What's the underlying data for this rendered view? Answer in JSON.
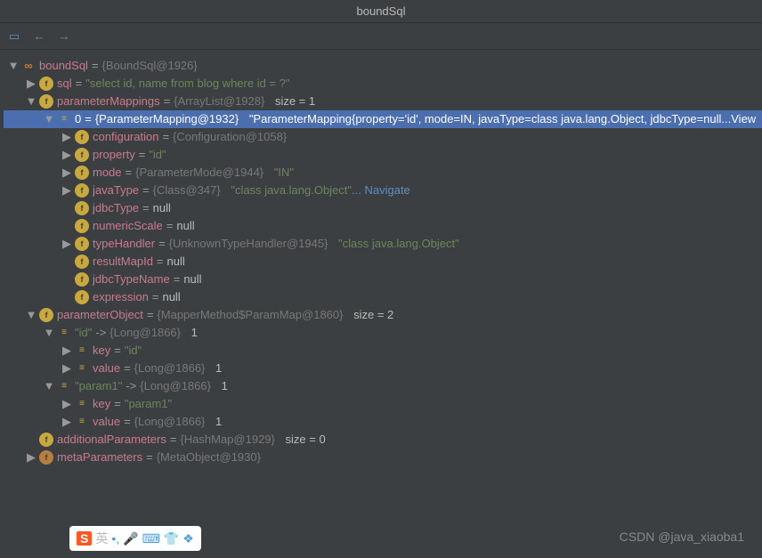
{
  "title": "boundSql",
  "watermark": "CSDN @java_xiaoba1",
  "tree": {
    "root": {
      "name": "boundSql",
      "type": "{BoundSql@1926}"
    },
    "sql": {
      "name": "sql",
      "val": "\"select id, name from blog where id = ?\""
    },
    "parameterMappings": {
      "name": "parameterMappings",
      "type": "{ArrayList@1928}",
      "size": "size = 1"
    },
    "pm0": {
      "name": "0",
      "type": "{ParameterMapping@1932}",
      "val": "\"ParameterMapping{property='id', mode=IN, javaType=class java.lang.Object, jdbcType=null...",
      "view": "View"
    },
    "configuration": {
      "name": "configuration",
      "type": "{Configuration@1058}"
    },
    "property": {
      "name": "property",
      "val": "\"id\""
    },
    "mode": {
      "name": "mode",
      "type": "{ParameterMode@1944}",
      "val": "\"IN\""
    },
    "javaType": {
      "name": "javaType",
      "type": "{Class@347}",
      "val": "\"class java.lang.Object\"",
      "nav": "... Navigate"
    },
    "jdbcType": {
      "name": "jdbcType",
      "val": "null"
    },
    "numericScale": {
      "name": "numericScale",
      "val": "null"
    },
    "typeHandler": {
      "name": "typeHandler",
      "type": "{UnknownTypeHandler@1945}",
      "val": "\"class java.lang.Object\""
    },
    "resultMapId": {
      "name": "resultMapId",
      "val": "null"
    },
    "jdbcTypeName": {
      "name": "jdbcTypeName",
      "val": "null"
    },
    "expression": {
      "name": "expression",
      "val": "null"
    },
    "parameterObject": {
      "name": "parameterObject",
      "type": "{MapperMethod$ParamMap@1860}",
      "size": "size = 2"
    },
    "entry_id": {
      "name": "\"id\"",
      "arrow": "->",
      "type": "{Long@1866}",
      "val": "1"
    },
    "key_id": {
      "name": "key",
      "val": "\"id\""
    },
    "value_id": {
      "name": "value",
      "type": "{Long@1866}",
      "val": "1"
    },
    "entry_param1": {
      "name": "\"param1\"",
      "arrow": "->",
      "type": "{Long@1866}",
      "val": "1"
    },
    "key_param1": {
      "name": "key",
      "val": "\"param1\""
    },
    "value_param1": {
      "name": "value",
      "type": "{Long@1866}",
      "val": "1"
    },
    "additionalParameters": {
      "name": "additionalParameters",
      "type": "{HashMap@1929}",
      "size": "size = 0"
    },
    "metaParameters": {
      "name": "metaParameters",
      "type": "{MetaObject@1930}"
    }
  },
  "taskbar": {
    "s": "S",
    "lang": "英"
  }
}
